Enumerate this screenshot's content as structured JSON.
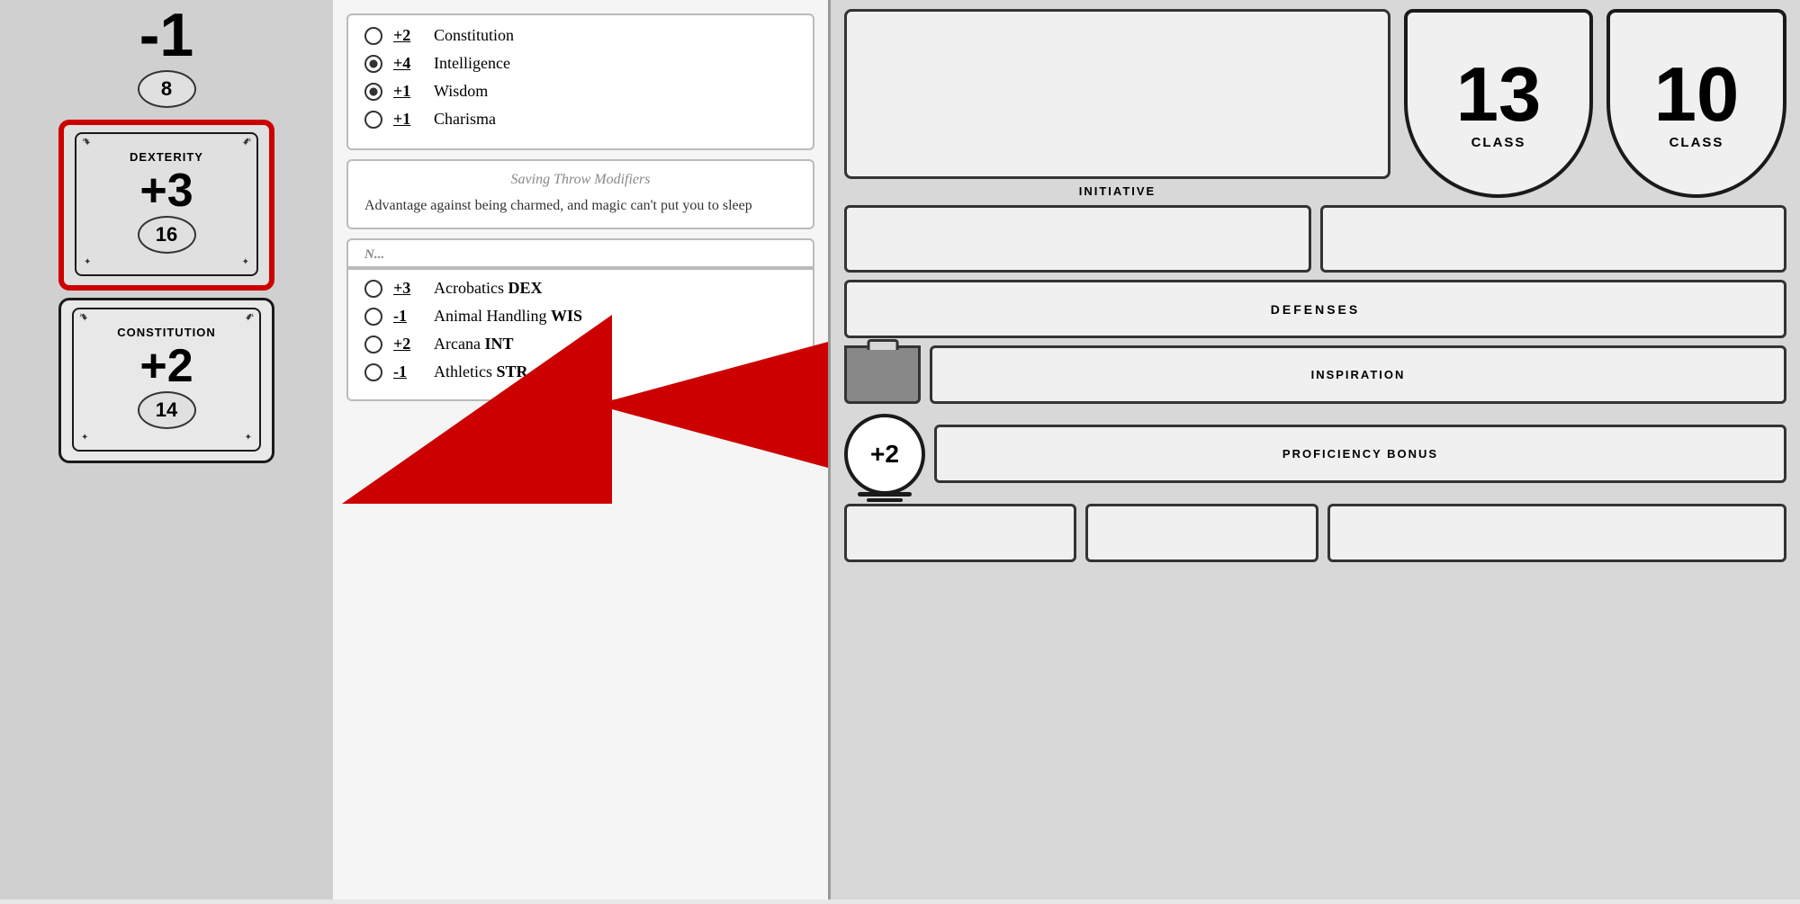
{
  "leftPanel": {
    "partialTop": {
      "modifier": "-1",
      "score": "8"
    },
    "dexterity": {
      "name": "DEXTERITY",
      "modifier": "+3",
      "score": "16",
      "highlighted": true
    },
    "constitution": {
      "name": "CONSTITUTION",
      "modifier": "+2",
      "score": "14"
    }
  },
  "middlePanel": {
    "savingThrows": {
      "items": [
        {
          "value": "+2",
          "name": "Constitution",
          "checked": false
        },
        {
          "value": "+4",
          "name": "Intelligence",
          "checked": true
        },
        {
          "value": "+1",
          "name": "Wisdom",
          "checked": true
        },
        {
          "value": "+1",
          "name": "Charisma",
          "checked": false
        }
      ]
    },
    "savingThrowModifiers": {
      "header": "Saving Throw Modifiers",
      "text": "Advantage against being charmed, and magic can't put you to sleep"
    },
    "skills": {
      "items": [
        {
          "value": "+3",
          "name": "Acrobatics",
          "attr": "DEX",
          "checked": false
        },
        {
          "value": "-1",
          "name": "Animal Handling",
          "attr": "WIS",
          "checked": false
        },
        {
          "value": "+2",
          "name": "Arcana",
          "attr": "INT",
          "checked": false
        },
        {
          "value": "-1",
          "name": "Athletics",
          "attr": "STR",
          "checked": false
        }
      ]
    }
  },
  "rightPanel": {
    "initiative": {
      "label": "INITIATIVE"
    },
    "classBadge": {
      "number": "13",
      "label": "CLASS"
    },
    "topBadge": {
      "number": "10",
      "label": "CLASS"
    },
    "defenses": {
      "label": "DEFENSES"
    },
    "inspiration": {
      "label": "INSPIRATION"
    },
    "proficiencyBonus": {
      "value": "+2",
      "label": "PROFICIENCY BONUS"
    }
  }
}
